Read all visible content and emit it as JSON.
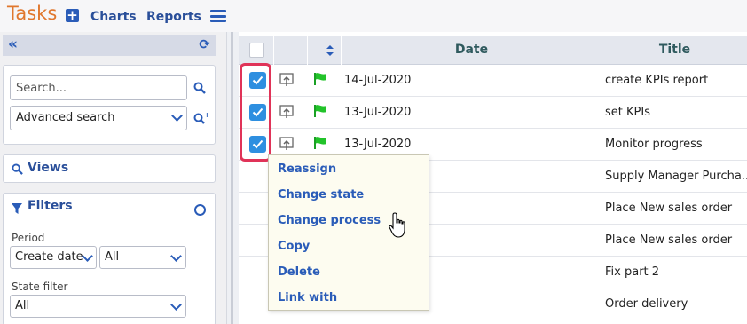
{
  "header": {
    "app_title": "Tasks",
    "nav": [
      "Charts",
      "Reports"
    ]
  },
  "sidebar": {
    "search": {
      "placeholder": "Search...",
      "advanced": "Advanced search"
    },
    "views_label": "Views",
    "filters": {
      "title": "Filters",
      "period_label": "Period",
      "period_field": "Create date",
      "period_value": "All",
      "state_label": "State filter",
      "state_value": "All"
    }
  },
  "grid": {
    "columns": [
      "Date",
      "Title"
    ],
    "rows": [
      {
        "date": "14-Jul-2020",
        "title": "create KPIs report",
        "checked": true
      },
      {
        "date": "13-Jul-2020",
        "title": "set KPIs",
        "checked": true
      },
      {
        "date": "13-Jul-2020",
        "title": "Monitor progress",
        "checked": true
      },
      {
        "date": "",
        "title": "Supply Manager Purcha...",
        "checked": false
      },
      {
        "date": "",
        "title": "Place New sales order",
        "checked": false
      },
      {
        "date": "",
        "title": "Place New sales order",
        "checked": false
      },
      {
        "date": "",
        "title": "Fix part 2",
        "checked": false
      },
      {
        "date": "",
        "title": "Order delivery",
        "checked": false
      }
    ]
  },
  "context_menu": {
    "items": [
      "Reassign",
      "Change state",
      "Change process",
      "Copy",
      "Delete",
      "Link with"
    ]
  },
  "colors": {
    "accent": "#2a5cb8",
    "title_orange": "#e0772d",
    "checkbox_blue": "#2e8fe0",
    "highlight_red": "#e03358",
    "flag_green": "#22c32a"
  }
}
